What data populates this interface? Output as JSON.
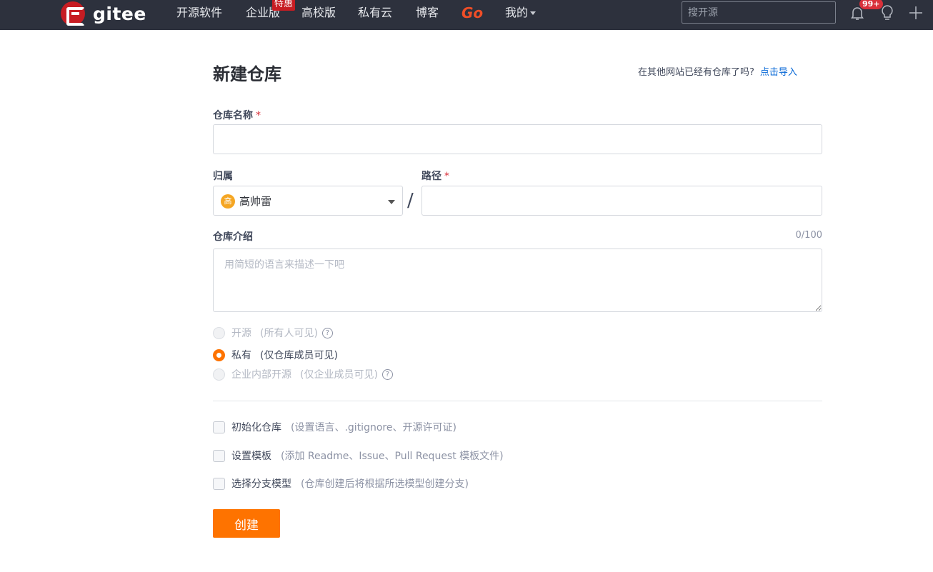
{
  "nav": {
    "logo_text": "gitee",
    "items": [
      "开源软件",
      "企业版",
      "高校版",
      "私有云",
      "博客"
    ],
    "go_label": "Go",
    "badge": "特惠",
    "mine_label": "我的",
    "search_placeholder": "搜开源",
    "notification_count": "99+"
  },
  "form": {
    "title": "新建仓库",
    "import_hint": "在其他网站已经有仓库了吗?",
    "import_link": "点击导入",
    "repo_name_label": "仓库名称",
    "required_mark": "*",
    "owner_label": "归属",
    "owner_name": "高帅雷",
    "owner_avatar_char": "高",
    "path_label": "路径",
    "path_separator": "/",
    "desc_label": "仓库介绍",
    "desc_counter": "0/100",
    "desc_placeholder": "用简短的语言来描述一下吧",
    "visibility": [
      {
        "label": "开源",
        "note": "(所有人可见)",
        "state": "disabled",
        "help": true
      },
      {
        "label": "私有",
        "note": "(仅仓库成员可见)",
        "state": "checked",
        "help": false
      },
      {
        "label": "企业内部开源",
        "note": "(仅企业成员可见)",
        "state": "disabled",
        "help": true
      }
    ],
    "options": [
      {
        "label": "初始化仓库",
        "note": "(设置语言、.gitignore、开源许可证)"
      },
      {
        "label": "设置模板",
        "note": "(添加 Readme、Issue、Pull Request 模板文件)"
      },
      {
        "label": "选择分支模型",
        "note": "(仓库创建后将根据所选模型创建分支)"
      }
    ],
    "submit_label": "创建"
  },
  "colors": {
    "nav_bg": "#2d313d",
    "brand_red": "#c71d23",
    "accent_orange": "#fe7300",
    "link_blue": "#0366d6"
  }
}
